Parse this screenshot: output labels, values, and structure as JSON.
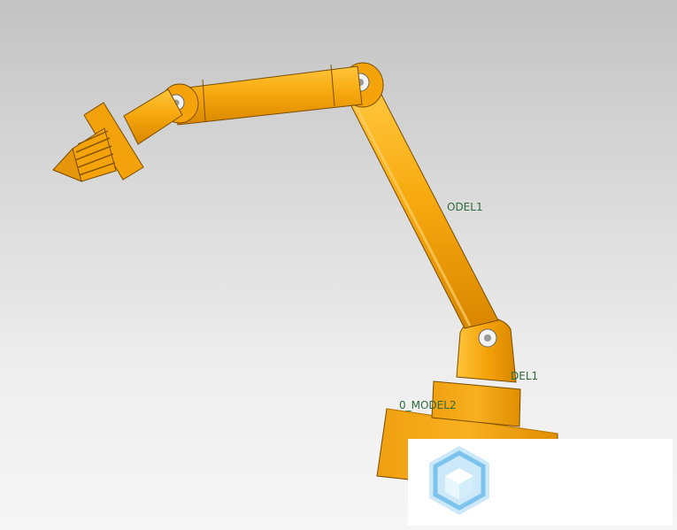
{
  "viewport": {
    "background_top": "#c3c3c3",
    "background_bottom": "#f6f6f6"
  },
  "model": {
    "body_color": "#f5a30a",
    "shade_color": "#d98600",
    "highlight_color": "#ffc53b",
    "edge_color": "#5a3a00"
  },
  "labels": {
    "model1_upper": "ODEL1",
    "model1_lower": "DEL1",
    "model2": "0_MODEL2"
  },
  "overlay": {
    "logo_icon": "cube-logo-icon",
    "logo_color": "#7cc3ee"
  }
}
